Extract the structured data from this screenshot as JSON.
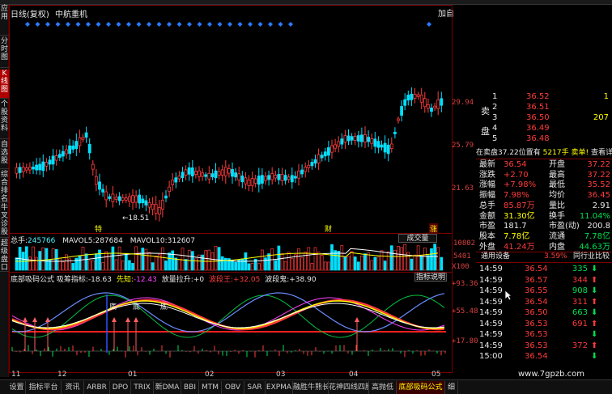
{
  "header": {
    "mode": "日线(复权)",
    "stock_name": "中航重机",
    "corner_label": "加自"
  },
  "left_tabs": [
    {
      "label": "应用",
      "active": false
    },
    {
      "label": "分时图",
      "active": false
    },
    {
      "label": "K线图",
      "active": true
    },
    {
      "label": "个股资料",
      "active": false
    },
    {
      "label": "自选股",
      "active": false
    },
    {
      "label": "综合排名",
      "active": false
    },
    {
      "label": "牛叉诊股",
      "active": false
    },
    {
      "label": "超级盘口",
      "active": false
    }
  ],
  "price_axis": [
    "29.94",
    "25.79",
    "21.63"
  ],
  "price_annotations": {
    "low": "←18.51",
    "tag1": "特",
    "tag2": "财",
    "tag3": "涨"
  },
  "volume_panel": {
    "total_label": "总手:",
    "total_value": "245766",
    "mavol5_label": "MAVOL5:",
    "mavol5_value": "287684",
    "mavol10_label": "MAVOL10:",
    "mavol10_value": "312607",
    "button": "成交量",
    "axis_top": "10802",
    "axis_mid": "5401",
    "axis_unit": "X100"
  },
  "indicator_panel": {
    "name": "底部吸码公式",
    "i1_label": "吸筹指标:",
    "i1_value": "-18.63",
    "i2_label": "先知:",
    "i2_value": "-12.43",
    "i3_label": "放量拉升:",
    "i3_value": "+0",
    "i4_label": "波段王:",
    "i4_value": "+32.05",
    "i5_label": "波段鬼:",
    "i5_value": "+38.90",
    "button": "指标说明",
    "axis": [
      "+93.36",
      "+55.48",
      "+17.80"
    ],
    "markers": [
      "底",
      "底",
      "底"
    ]
  },
  "x_axis": [
    "11",
    "12",
    "01",
    "02",
    "03",
    "04",
    "05"
  ],
  "quote": {
    "sell_label": "卖",
    "buy_label": "买",
    "plate_label": "盘",
    "asks": [
      {
        "level": "1",
        "price": "36.52"
      },
      {
        "level": "2",
        "price": "36.51"
      },
      {
        "level": "3",
        "price": "36.50"
      },
      {
        "level": "4",
        "price": "36.49"
      },
      {
        "level": "5",
        "price": "36.48"
      }
    ],
    "ask_right": [
      "1",
      "",
      "207",
      "",
      ""
    ],
    "sell_plate_label": "在卖盘",
    "sell_plate_price": "37.22",
    "sell_plate_pos": "位置有",
    "sell_plate_qty": "5217手",
    "sell_plate_action": "卖单!",
    "sell_plate_link": "查看详细",
    "stats": [
      {
        "l1": "最新",
        "v1": "36.54",
        "l2": "开盘",
        "v2": "37.22"
      },
      {
        "l1": "涨跌",
        "v1": "+2.70",
        "l2": "最高",
        "v2": "37.22"
      },
      {
        "l1": "涨幅",
        "v1": "+7.98%",
        "l2": "最低",
        "v2": "35.52"
      },
      {
        "l1": "振幅",
        "v1": "7.98%",
        "l2": "均价",
        "v2": "36.45"
      },
      {
        "l1": "总手",
        "v1": "85.87万",
        "l2": "量比",
        "v2": "2.91"
      },
      {
        "l1": "金额",
        "v1": "31.30亿",
        "l2": "换手",
        "v2": "11.04%"
      },
      {
        "l1": "市盈",
        "v1": "181.7",
        "l2": "市盈(动)",
        "v2": "200.8"
      },
      {
        "l1": "股本",
        "v1": "7.78亿",
        "l2": "流通",
        "v2": "7.78亿"
      },
      {
        "l1": "外盘",
        "v1": "41.24万",
        "l2": "内盘",
        "v2": "44.63万"
      }
    ],
    "device_label": "通用设备",
    "device_pct": "3.59%",
    "compare_label": "同行业比较",
    "ticks": [
      {
        "time": "14:59",
        "price": "36.54",
        "qty": "335",
        "dir": "down"
      },
      {
        "time": "14:59",
        "price": "36.57",
        "qty": "344",
        "dir": "up"
      },
      {
        "time": "14:59",
        "price": "36.55",
        "qty": "908",
        "dir": "down"
      },
      {
        "time": "14:59",
        "price": "36.54",
        "qty": "311",
        "dir": "up"
      },
      {
        "time": "14:59",
        "price": "36.50",
        "qty": "663",
        "dir": "down"
      },
      {
        "time": "14:59",
        "price": "36.53",
        "qty": "691",
        "dir": "up"
      },
      {
        "time": "14:59",
        "price": "36.53",
        "qty": "",
        "dir": "down"
      },
      {
        "time": "14:59",
        "price": "36.53",
        "qty": "372",
        "dir": "up"
      },
      {
        "time": "15:00",
        "price": "36.54",
        "qty": "",
        "dir": "down"
      }
    ]
  },
  "bottom_tabs": [
    {
      "label": "设置",
      "active": false
    },
    {
      "label": "指标平台",
      "active": false
    },
    {
      "label": "资讯",
      "active": false
    },
    {
      "label": "ARBR",
      "active": false
    },
    {
      "label": "DPO",
      "active": false
    },
    {
      "label": "TRIX",
      "active": false
    },
    {
      "label": "新DMA",
      "active": false
    },
    {
      "label": "BBI",
      "active": false
    },
    {
      "label": "MTM",
      "active": false
    },
    {
      "label": "OBV",
      "active": false
    },
    {
      "label": "SAR",
      "active": false
    },
    {
      "label": "EXPMA",
      "active": false
    },
    {
      "label": "融胜牛熊长",
      "active": false
    },
    {
      "label": "花神四线四胜",
      "active": false
    },
    {
      "label": "高抛低",
      "active": false
    },
    {
      "label": "底部吸码公式",
      "active": true
    },
    {
      "label": "细",
      "active": false
    }
  ],
  "watermark": "www.7gpzb.com",
  "colors": {
    "up": "#ff3b3b",
    "down": "#00e0ff",
    "grid": "#7a0000",
    "ma_yellow": "#ffff00",
    "ma_white": "#ffffff"
  }
}
